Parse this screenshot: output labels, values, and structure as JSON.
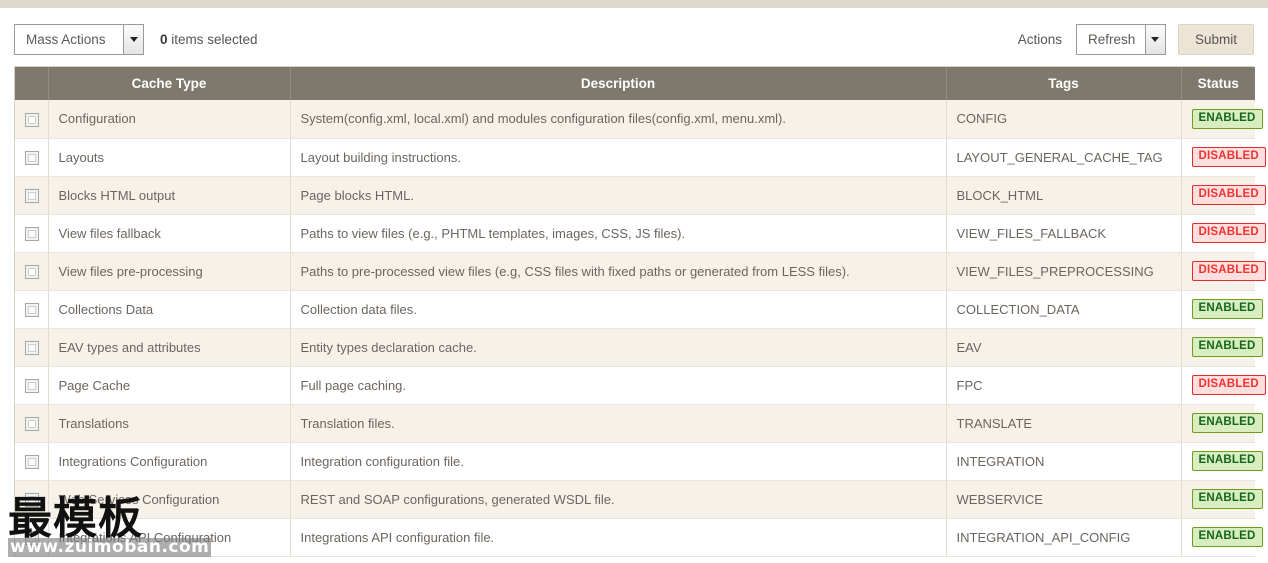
{
  "toolbar": {
    "mass_actions_label": "Mass Actions",
    "items_selected_count": "0",
    "items_selected_text": "items selected",
    "actions_label": "Actions",
    "refresh_label": "Refresh",
    "submit_label": "Submit"
  },
  "grid": {
    "columns": [
      "",
      "Cache Type",
      "Description",
      "Tags",
      "Status"
    ],
    "rows": [
      {
        "cache_type": "Configuration",
        "description": "System(config.xml, local.xml) and modules configuration files(config.xml, menu.xml).",
        "tags": "CONFIG",
        "status": "ENABLED"
      },
      {
        "cache_type": "Layouts",
        "description": "Layout building instructions.",
        "tags": "LAYOUT_GENERAL_CACHE_TAG",
        "status": "DISABLED"
      },
      {
        "cache_type": "Blocks HTML output",
        "description": "Page blocks HTML.",
        "tags": "BLOCK_HTML",
        "status": "DISABLED"
      },
      {
        "cache_type": "View files fallback",
        "description": "Paths to view files (e.g., PHTML templates, images, CSS, JS files).",
        "tags": "VIEW_FILES_FALLBACK",
        "status": "DISABLED"
      },
      {
        "cache_type": "View files pre-processing",
        "description": "Paths to pre-processed view files (e.g, CSS files with fixed paths or generated from LESS files).",
        "tags": "VIEW_FILES_PREPROCESSING",
        "status": "DISABLED"
      },
      {
        "cache_type": "Collections Data",
        "description": "Collection data files.",
        "tags": "COLLECTION_DATA",
        "status": "ENABLED"
      },
      {
        "cache_type": "EAV types and attributes",
        "description": "Entity types declaration cache.",
        "tags": "EAV",
        "status": "ENABLED"
      },
      {
        "cache_type": "Page Cache",
        "description": "Full page caching.",
        "tags": "FPC",
        "status": "DISABLED"
      },
      {
        "cache_type": "Translations",
        "description": "Translation files.",
        "tags": "TRANSLATE",
        "status": "ENABLED"
      },
      {
        "cache_type": "Integrations Configuration",
        "description": "Integration configuration file.",
        "tags": "INTEGRATION",
        "status": "ENABLED"
      },
      {
        "cache_type": "Web Services Configuration",
        "description": "REST and SOAP configurations, generated WSDL file.",
        "tags": "WEBSERVICE",
        "status": "ENABLED"
      },
      {
        "cache_type": "Integrations API Configuration",
        "description": "Integrations API configuration file.",
        "tags": "INTEGRATION_API_CONFIG",
        "status": "ENABLED"
      }
    ]
  },
  "watermark": {
    "cjk": "最模板",
    "url": "www.zuimoban.com"
  },
  "colors": {
    "header_bg": "#7e786d",
    "row_alt_bg": "#f6f2e9",
    "enabled_text": "#14661a",
    "disabled_text": "#f03434",
    "top_strip": "#dfd9cd",
    "submit_bg": "#ece4d5"
  }
}
